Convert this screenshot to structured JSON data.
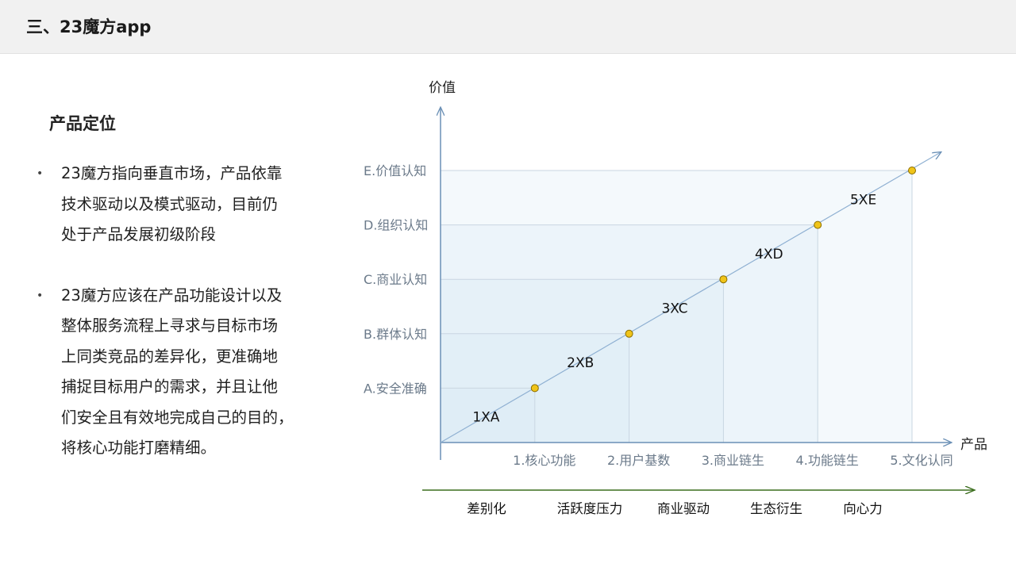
{
  "header": {
    "title": "三、23魔方app"
  },
  "left": {
    "section_title": "产品定位",
    "bullets": [
      {
        "lines": [
          "23魔方指向垂直市场，产品依靠",
          "技术驱动以及模式驱动，目前仍",
          "处于产品发展初级阶段"
        ]
      },
      {
        "lines": [
          "23魔方应该在产品功能设计以及",
          "整体服务流程上寻求与目标市场",
          "上同类竞品的差异化，更准确地",
          "捕捉目标用户的需求，并且让他",
          "们安全且有效地完成自己的目的，",
          "将核心功能打磨精细。"
        ]
      }
    ]
  },
  "chart_data": {
    "type": "line",
    "ylabel": "价值",
    "xlabel": "产品",
    "x_categories": [
      "1.核心功能",
      "2.用户基数",
      "3.商业链生",
      "4.功能链生",
      "5.文化认同"
    ],
    "y_categories": [
      "A.安全准确",
      "B.群体认知",
      "C.商业认知",
      "D.组织认知",
      "E.价值认知"
    ],
    "points": [
      {
        "label": "1XA",
        "x": 1,
        "y": 1
      },
      {
        "label": "2XB",
        "x": 2,
        "y": 2
      },
      {
        "label": "3XC",
        "x": 3,
        "y": 3
      },
      {
        "label": "4XD",
        "x": 4,
        "y": 4
      },
      {
        "label": "5XE",
        "x": 5,
        "y": 5
      }
    ],
    "bottom_labels": [
      "差别化",
      "活跃度压力",
      "商业驱动",
      "生态衍生",
      "向心力"
    ],
    "colors": {
      "axis": "#6a8fb5",
      "point_fill": "#f0c419",
      "point_stroke": "#8a6d00",
      "region": "#d8e8f5",
      "bottom_arrow": "#3c6e1e"
    }
  }
}
